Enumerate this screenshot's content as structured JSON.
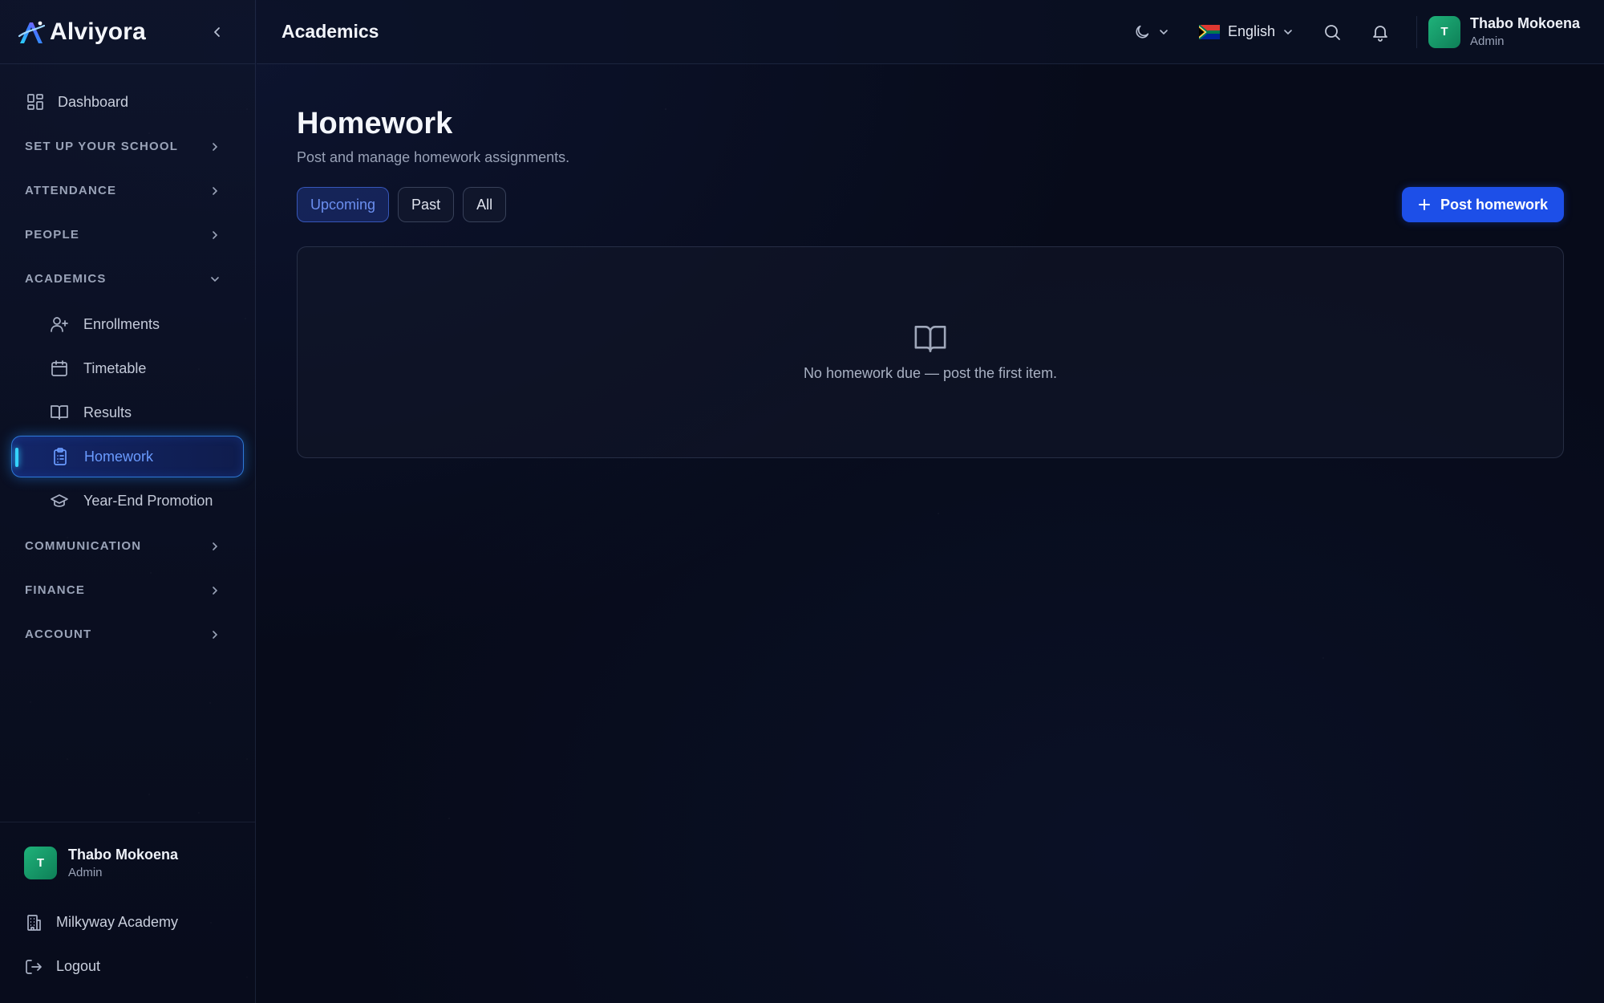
{
  "brand": {
    "name": "Alviyora"
  },
  "sidebar": {
    "dashboard_label": "Dashboard",
    "sections": {
      "setup": "SET UP YOUR SCHOOL",
      "attendance": "ATTENDANCE",
      "people": "PEOPLE",
      "academics": "ACADEMICS",
      "communication": "COMMUNICATION",
      "finance": "FINANCE",
      "account": "ACCOUNT"
    },
    "academics_items": {
      "enrollments": "Enrollments",
      "timetable": "Timetable",
      "results": "Results",
      "homework": "Homework",
      "promotion": "Year-End Promotion"
    },
    "footer": {
      "user_initial": "T",
      "user_name": "Thabo Mokoena",
      "user_role": "Admin",
      "school_name": "Milkyway Academy",
      "logout_label": "Logout"
    }
  },
  "topbar": {
    "title": "Academics",
    "language": "English",
    "user_initial": "T",
    "user_name": "Thabo Mokoena",
    "user_role": "Admin"
  },
  "main": {
    "title": "Homework",
    "subtitle": "Post and manage homework assignments.",
    "tabs": {
      "upcoming": "Upcoming",
      "past": "Past",
      "all": "All"
    },
    "post_button": "Post homework",
    "empty_message": "No homework due — post the first item."
  },
  "colors": {
    "accent": "#1d4fe8",
    "active_glow": "#35d3ff",
    "avatar_green": "#1fb27a"
  }
}
